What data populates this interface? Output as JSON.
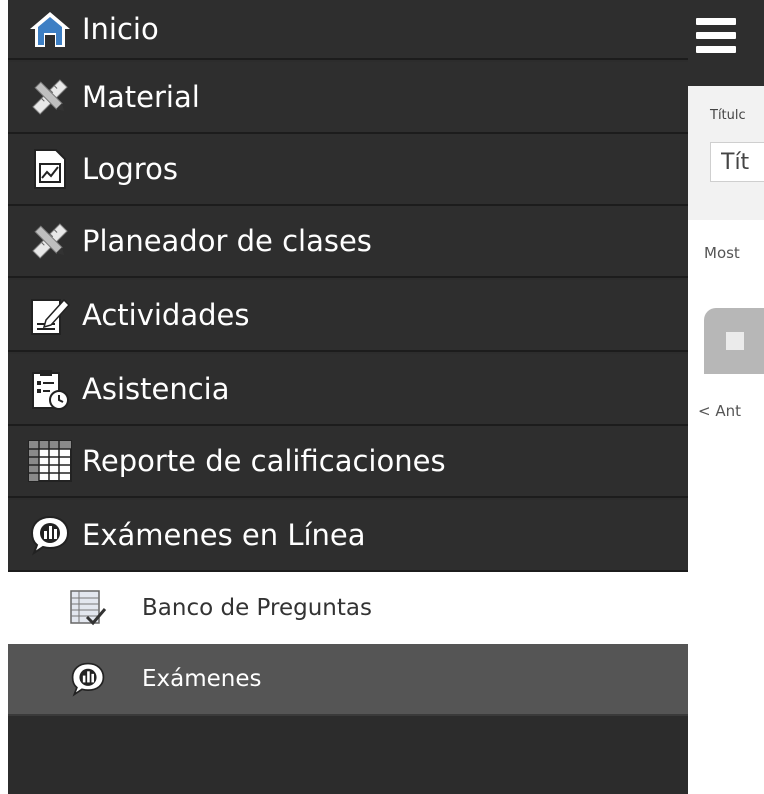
{
  "sidebar": {
    "items": [
      {
        "label": "Inicio",
        "icon": "home-icon"
      },
      {
        "label": "Material",
        "icon": "ruler-pencil-icon"
      },
      {
        "label": "Logros",
        "icon": "chart-document-icon"
      },
      {
        "label": "Planeador de clases",
        "icon": "ruler-pencil-icon"
      },
      {
        "label": "Actividades",
        "icon": "edit-document-icon"
      },
      {
        "label": "Asistencia",
        "icon": "clipboard-clock-icon"
      },
      {
        "label": "Reporte de calificaciones",
        "icon": "grid-report-icon"
      },
      {
        "label": "Exámenes en Línea",
        "icon": "chat-chart-icon"
      }
    ],
    "subitems": [
      {
        "label": "Banco de Preguntas",
        "icon": "checklist-icon"
      },
      {
        "label": "Exámenes",
        "icon": "chat-chart-icon"
      }
    ]
  },
  "header": {
    "menu_icon": "hamburger-icon"
  },
  "filters": {
    "title_label": "Títulc",
    "title_input_value": "Tít"
  },
  "content": {
    "show_label": "Most",
    "prev_link": "< Ant"
  },
  "colors": {
    "sidebar_bg": "#2e2e2e",
    "subitem_active_bg": "#555555",
    "subitem_light_bg": "#ffffff"
  }
}
